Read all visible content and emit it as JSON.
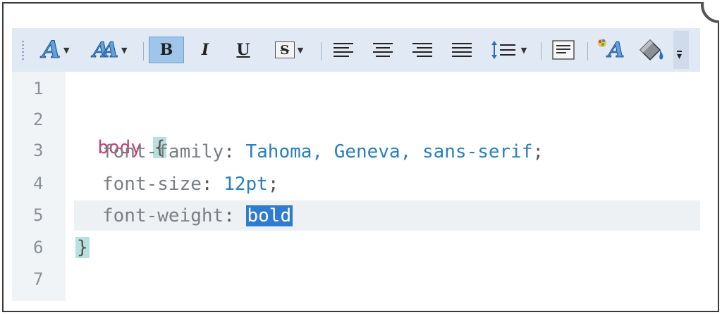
{
  "toolbar": {
    "icons": [
      "text-style-icon",
      "font-icon",
      "bold-icon",
      "italic-icon",
      "underline-icon",
      "strikethrough-icon",
      "align-left-icon",
      "align-center-icon",
      "align-right-icon",
      "justify-icon",
      "line-spacing-icon",
      "paragraph-icon",
      "font-color-icon",
      "fill-color-icon"
    ],
    "bold_label": "B",
    "italic_label": "I",
    "underline_label": "U",
    "strike_label": "S",
    "text_style_label": "A",
    "font_label": "A",
    "font_color_label": "A",
    "accent_color": "#9fc6ea"
  },
  "editor": {
    "lines": [
      {
        "num": "1",
        "selector": "",
        "open": "",
        "prop": "",
        "colon": "",
        "value": "",
        "semi": "",
        "close": ""
      },
      {
        "num": "2",
        "selector": "body",
        "open": "{"
      },
      {
        "num": "3",
        "prop": "font-family",
        "colon": ": ",
        "value": "Tahoma, Geneva, sans-serif",
        "semi": ";"
      },
      {
        "num": "4",
        "prop": "font-size",
        "colon": ": ",
        "value": "12pt",
        "semi": ";"
      },
      {
        "num": "5",
        "prop": "font-weight",
        "colon": ": ",
        "value": "bold",
        "semi": ""
      },
      {
        "num": "6",
        "close": "}"
      },
      {
        "num": "7"
      }
    ],
    "colors": {
      "selector": "#c2417a",
      "property": "#7a7f84",
      "value": "#2a7fc0",
      "selection": "#2f7bd1",
      "brace_match": "#b8e0dc"
    }
  }
}
